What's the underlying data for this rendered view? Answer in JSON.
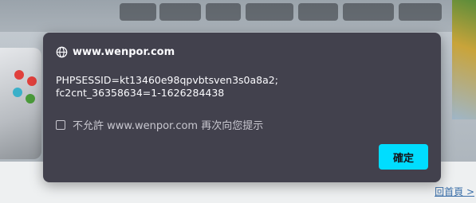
{
  "dialog": {
    "origin": "www.wenpor.com",
    "message_lines": [
      "PHPSESSID=kt13460e98qpvbtsven3s0a8a2;",
      "fc2cnt_36358634=1-1626284438"
    ],
    "suppress_checkbox_label": "不允許 www.wenpor.com 再次向您提示",
    "suppress_checked": false,
    "ok_label": "確定",
    "accent_color": "#00ddff",
    "background_color": "#42414d",
    "icon": "globe-icon"
  },
  "page": {
    "footer_link": "回首頁 >"
  }
}
